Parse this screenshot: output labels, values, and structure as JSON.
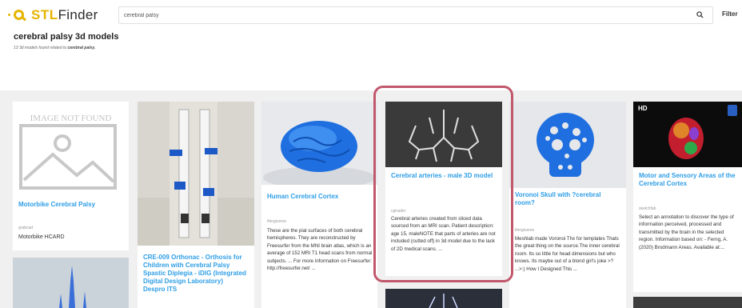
{
  "header": {
    "logo_stl": "STL",
    "logo_finder": "Finder",
    "search_value": "cerebral palsy",
    "filter_label": "Filter"
  },
  "page": {
    "title": "cerebral palsy 3d models",
    "subtitle_prefix": "13 3d models found related to ",
    "subtitle_query": "cerebral palsy."
  },
  "cards": [
    {
      "image_label": "IMAGE NOT FOUND",
      "title": "Motorbike Cerebral Palsy",
      "source": "grabcad",
      "author": "Motorbike HCARD"
    },
    {
      "title": "CRE-009 Orthonac - Orthosis for Children with Cerebral Palsy Spastic Diplegia - iDIG (Integrated Digital Design Laboratory) Despro ITS"
    },
    {
      "title": "Human Cerebral Cortex",
      "source": "thingiverse",
      "desc": "These are the pial surfaces of both cerebral hemispheres. They are reconstructed by Freesurfer from the MNI brain atlas, which is an average of 152 MRI T1 head scans from normal subjects. ... For more information on Freesurfer: http://freesurfer.net/ ..."
    },
    {
      "title": "Cerebral arteries - male 3D model",
      "source": "cgtrader",
      "desc": "Cerebral arteries created from sliced data sourced from an MRI scan. Patient description: age 15, maleNOTE that parts of arteries are not included (cutted off) in 3d model due to the lack of 2D medical scans. ..."
    },
    {
      "title": "Voronoi Skull with ?cerebral room?",
      "source": "thingiverse",
      "desc": "Meshlab made Voronoi Thx for templates Thats the great thing on the source.The inner cerebral room. Its so little for head dimensions but who knows. Its maybe out of a blond girl's joke >? ...>:) How I Designed This ..."
    },
    {
      "title": "Motor and Sensory Areas of the Cerebral Cortex",
      "source": "sketchfab",
      "desc": "Select an annotation to discover the type of information perceived, processed and transmitted by the brain in the selected region. Information based on: - Ferng, A. (2020) Brodmann Areas. Available at:..."
    }
  ],
  "colors": {
    "accent_yellow": "#e5b400",
    "link_blue": "#2e9ee6",
    "highlight_rose": "#c1586b",
    "grid_bg": "#f0f0f0"
  }
}
